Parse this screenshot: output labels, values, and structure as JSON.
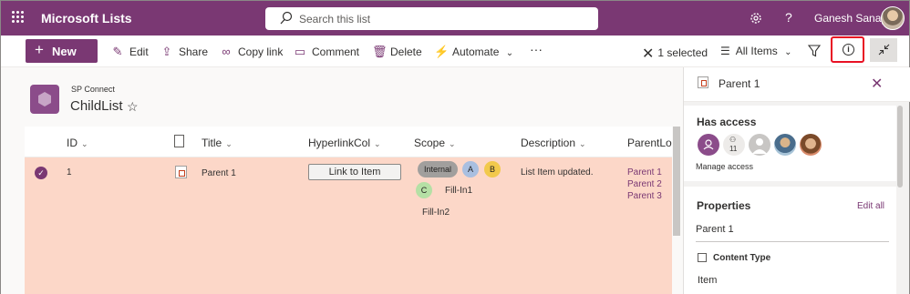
{
  "app": {
    "name": "Microsoft Lists"
  },
  "search": {
    "placeholder": "Search this list"
  },
  "user": {
    "name": "Ganesh Sanap"
  },
  "toolbar": {
    "new_label": "New",
    "edit_label": "Edit",
    "share_label": "Share",
    "copy_link_label": "Copy link",
    "comment_label": "Comment",
    "delete_label": "Delete",
    "automate_label": "Automate",
    "more_label": "···",
    "selected_label": "1 selected",
    "view_label": "All Items"
  },
  "site": {
    "name": "SP Connect",
    "list_title": "ChildList"
  },
  "columns": {
    "id": "ID",
    "title": "Title",
    "hyperlink": "HyperlinkCol",
    "scope": "Scope",
    "description": "Description",
    "parent": "ParentLoc"
  },
  "row": {
    "id": "1",
    "title": "Parent 1",
    "hyperlink_label": "Link to Item",
    "scope": {
      "internal": "Internal",
      "a": "A",
      "b": "B",
      "c": "C",
      "fill1": "Fill-In1",
      "fill2": "Fill-In2"
    },
    "description": "List Item updated.",
    "parents": [
      "Parent 1",
      "Parent 2",
      "Parent 3"
    ]
  },
  "pane": {
    "title": "Parent 1",
    "has_access": "Has access",
    "access_count": "11",
    "manage_access": "Manage access",
    "properties": "Properties",
    "edit_all": "Edit all",
    "title_value": "Parent 1",
    "content_type_label": "Content Type",
    "content_type_value": "Item"
  },
  "colors": {
    "brand": "#7a3873",
    "row_selected": "#fcd7c8",
    "highlight_border": "#e81123"
  }
}
